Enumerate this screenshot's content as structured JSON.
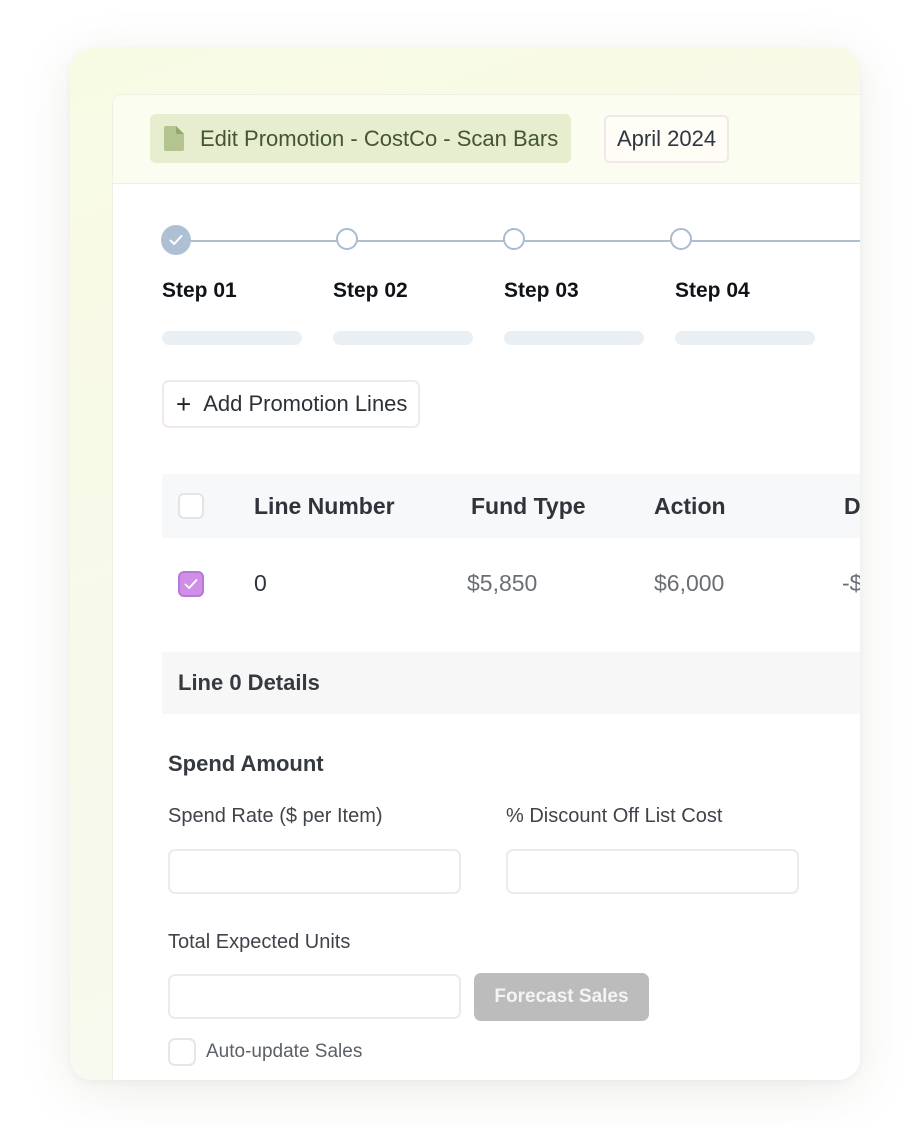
{
  "header": {
    "title": "Edit Promotion - CostCo - Scan Bars",
    "date": "April 2024"
  },
  "stepper": {
    "steps": [
      {
        "label": "Step 01",
        "status": "completed"
      },
      {
        "label": "Step 02",
        "status": "pending"
      },
      {
        "label": "Step 03",
        "status": "pending"
      },
      {
        "label": "Step 04",
        "status": "pending"
      }
    ]
  },
  "actions": {
    "add_lines_label": "Add Promotion Lines"
  },
  "table": {
    "columns": [
      "Line Number",
      "Fund Type",
      "Action",
      "D"
    ],
    "rows": [
      {
        "checked": true,
        "cells": [
          "0",
          "$5,850",
          "$6,000",
          "-$"
        ]
      }
    ]
  },
  "details": {
    "title": "Line 0 Details",
    "section_title": "Spend Amount",
    "spend_rate_label": "Spend Rate ($ per Item)",
    "spend_rate_value": "",
    "discount_label": "% Discount Off List Cost",
    "discount_value": "",
    "units_label": "Total Expected Units",
    "units_value": "",
    "forecast_label": "Forecast Sales",
    "auto_update_label": "Auto-update Sales",
    "auto_update_checked": false
  },
  "colors": {
    "title_chip_bg": "#e7eecf",
    "title_text": "#445533",
    "stepper_accent": "#aec0d3",
    "checkbox_checked": "#cf8fe8",
    "forecast_disabled": "#bcbcbc"
  }
}
